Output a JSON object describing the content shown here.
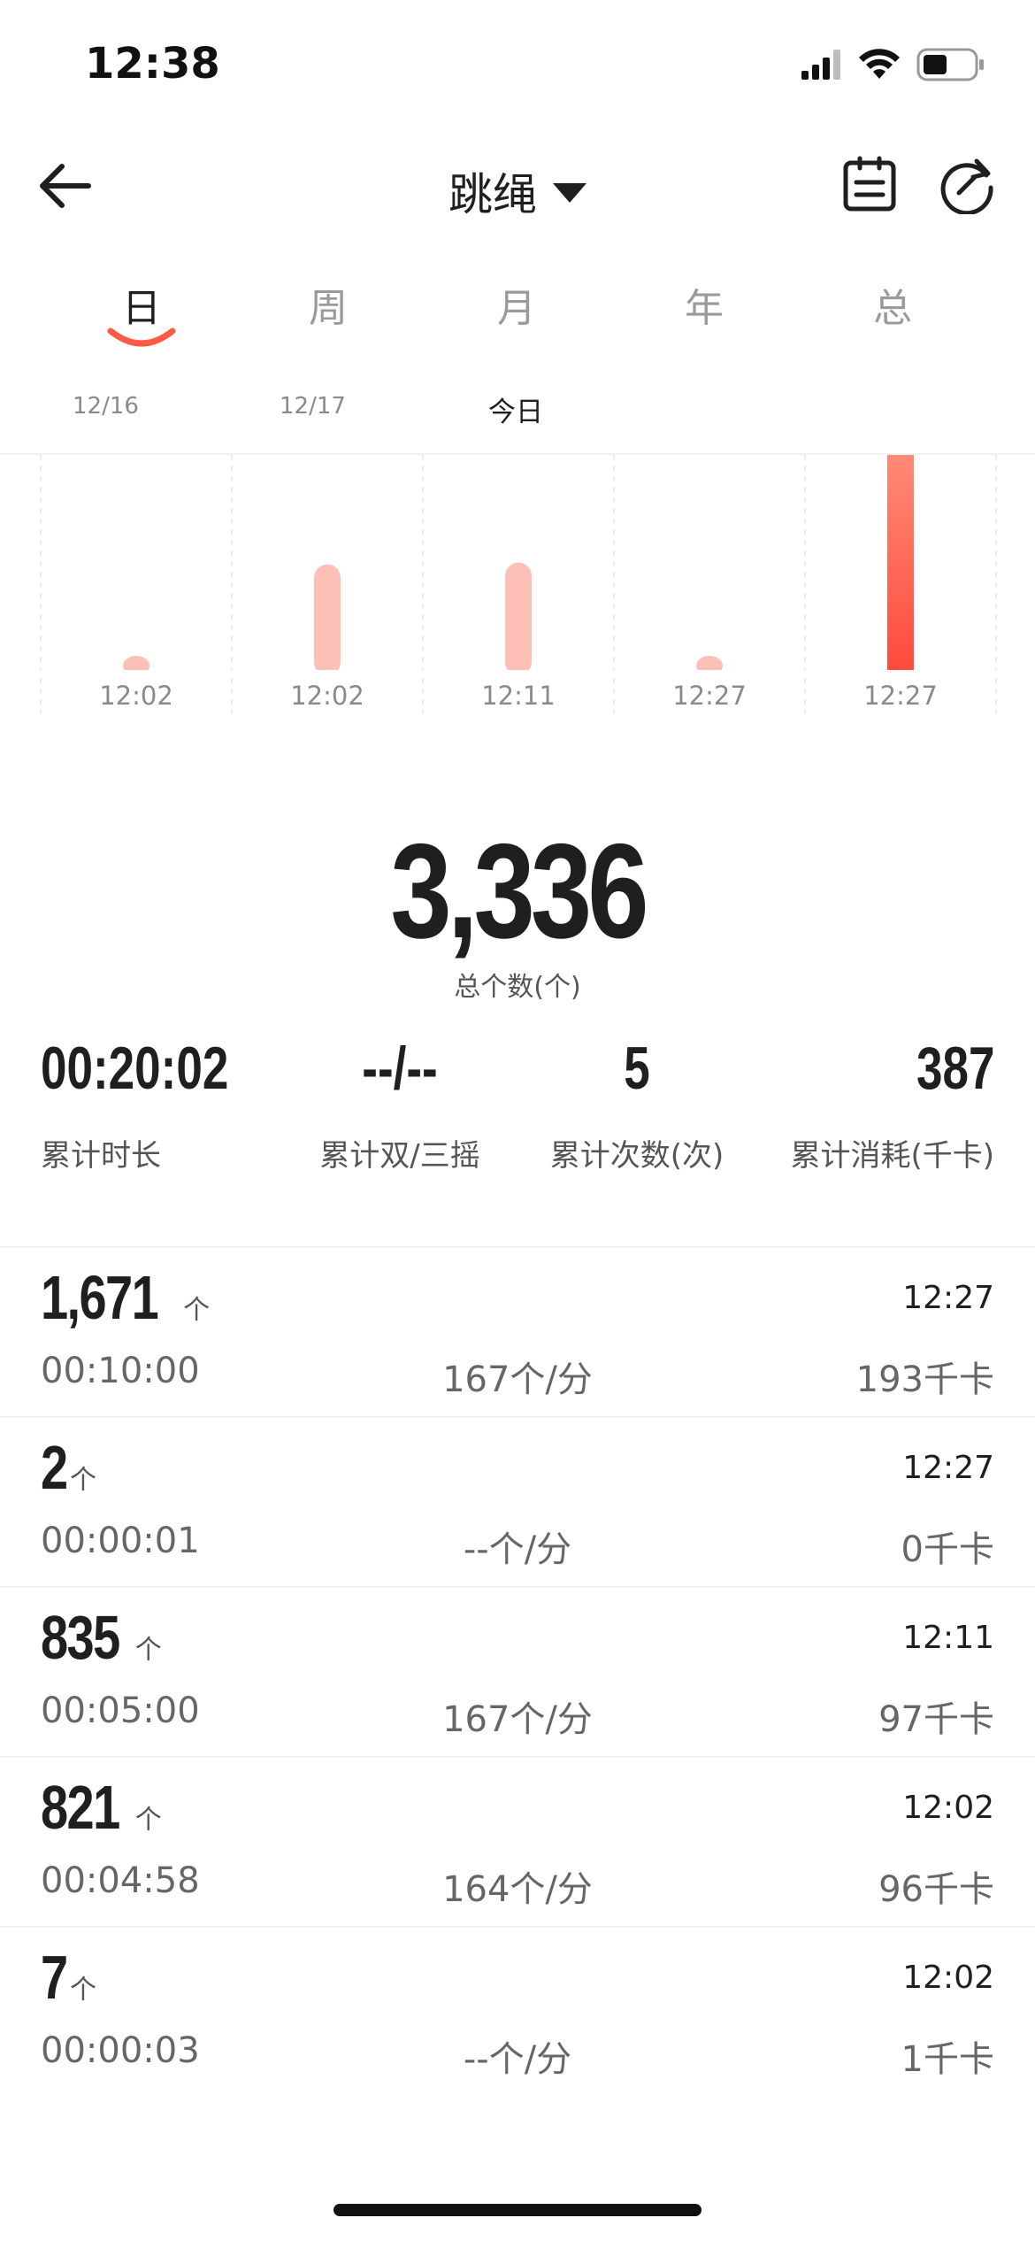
{
  "status_bar": {
    "time": "12:38"
  },
  "nav": {
    "title": "跳绳"
  },
  "tabs": [
    "日",
    "周",
    "月",
    "年",
    "总"
  ],
  "date_strip": [
    "12/16",
    "12/17",
    "今日"
  ],
  "chart_data": {
    "type": "bar",
    "categories": [
      "12:02",
      "12:02",
      "12:11",
      "12:27",
      "12:27"
    ],
    "values": [
      7,
      821,
      835,
      2,
      1671
    ],
    "highlighted_index": 4,
    "colors": {
      "normal": "#fcc0b6",
      "highlight_top": "#ff8a76",
      "highlight_bottom": "#ff4a3d"
    }
  },
  "summary": {
    "total": "3,336",
    "total_label": "总个数(个)",
    "stats": [
      {
        "value": "00:20:02",
        "label": "累计时长"
      },
      {
        "value": "--/--",
        "label": "累计双/三摇"
      },
      {
        "value": "5",
        "label": "累计次数(次)"
      },
      {
        "value": "387",
        "label": "累计消耗(千卡)"
      }
    ]
  },
  "records": [
    {
      "count": "1,671",
      "unit": "个",
      "time": "12:27",
      "duration": "00:10:00",
      "pace": "167个/分",
      "calories": "193千卡"
    },
    {
      "count": "2",
      "unit": "个",
      "time": "12:27",
      "duration": "00:00:01",
      "pace": "--个/分",
      "calories": "0千卡"
    },
    {
      "count": "835",
      "unit": "个",
      "time": "12:11",
      "duration": "00:05:00",
      "pace": "167个/分",
      "calories": "97千卡"
    },
    {
      "count": "821",
      "unit": "个",
      "time": "12:02",
      "duration": "00:04:58",
      "pace": "164个/分",
      "calories": "96千卡"
    },
    {
      "count": "7",
      "unit": "个",
      "time": "12:02",
      "duration": "00:00:03",
      "pace": "--个/分",
      "calories": "1千卡"
    }
  ],
  "icons": {
    "back": "arrow-left-icon",
    "dropdown": "caret-down-icon",
    "records": "clipboard-list-icon",
    "refresh": "refresh-icon",
    "signal": "cellular-signal-icon",
    "wifi": "wifi-icon",
    "battery": "battery-icon"
  },
  "colors": {
    "accent": "#ff5a45",
    "text": "#1f1f1f",
    "muted": "#9a9a9a"
  }
}
